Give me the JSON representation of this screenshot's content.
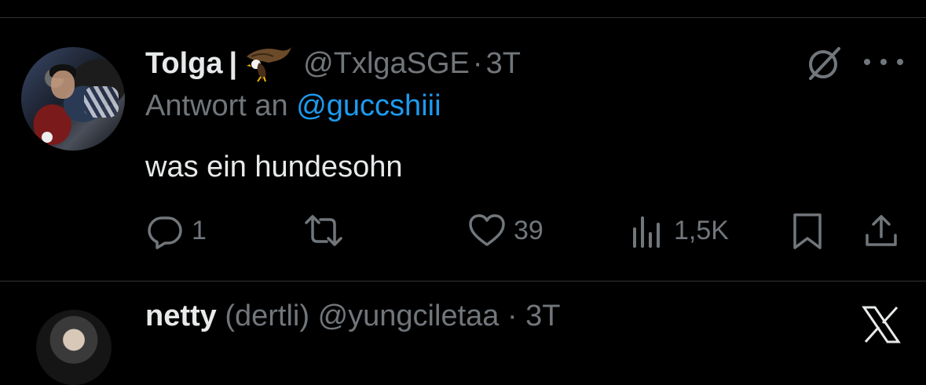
{
  "tweet": {
    "author_name": "Tolga",
    "separator": "|",
    "handle": "@TxlgaSGE",
    "dot": "·",
    "time": "3T",
    "reply_prefix": "Antwort an",
    "reply_to": "@guccshiii",
    "text": "was ein hundesohn",
    "actions": {
      "reply_count": "1",
      "retweet_count": "",
      "like_count": "39",
      "views_count": "1,5K"
    }
  },
  "next_tweet": {
    "author_name": "netty",
    "rest": " (dertli) @yungciletaa · 3T"
  },
  "icons": [
    "grok-icon",
    "more-icon",
    "reply-icon",
    "retweet-icon",
    "like-icon",
    "views-icon",
    "bookmark-icon",
    "share-icon",
    "x-logo-icon",
    "eagle-emoji-icon"
  ],
  "colors": {
    "background": "#000000",
    "text": "#e7e9ea",
    "muted": "#71767b",
    "link": "#1d9bf0",
    "divider": "#2f3336"
  }
}
